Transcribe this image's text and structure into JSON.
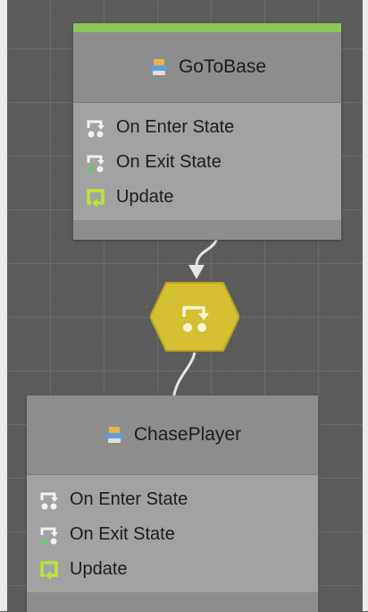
{
  "colors": {
    "accent_active": "#8ec65a",
    "transition_node": "#d4c030"
  },
  "nodes": [
    {
      "title": "GoToBase",
      "icon": "state-machine-icon",
      "events": [
        {
          "label": "On Enter State",
          "icon": "enter-state-icon"
        },
        {
          "label": "On Exit State",
          "icon": "exit-state-icon"
        },
        {
          "label": "Update",
          "icon": "update-loop-icon"
        }
      ]
    },
    {
      "title": "ChasePlayer",
      "icon": "state-machine-icon",
      "events": [
        {
          "label": "On Enter State",
          "icon": "enter-state-icon"
        },
        {
          "label": "On Exit State",
          "icon": "exit-state-icon"
        },
        {
          "label": "Update",
          "icon": "update-loop-icon"
        }
      ]
    }
  ],
  "transition": {
    "icon": "transition-icon"
  }
}
